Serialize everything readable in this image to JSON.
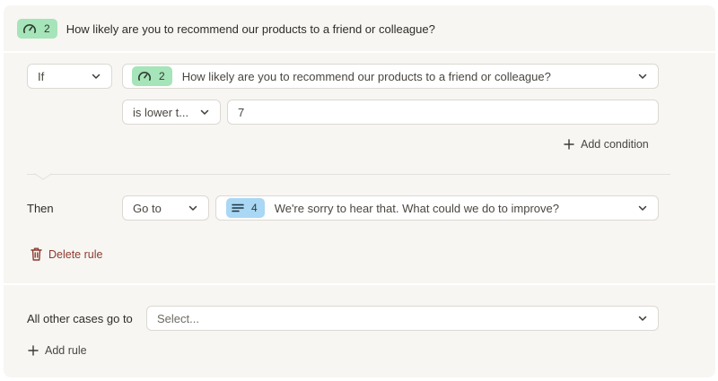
{
  "header": {
    "question_number": "2",
    "question_text": "How likely are you to recommend our products to a friend or colleague?",
    "question_icon": "gauge-icon"
  },
  "rule": {
    "if_label": "If",
    "condition_question_number": "2",
    "condition_question_text": "How likely are you to recommend our products to a friend or colleague?",
    "operator": "is lower t...",
    "value": "7",
    "add_condition_label": "Add condition",
    "then_label": "Then",
    "action": "Go to",
    "target_number": "4",
    "target_text": "We're sorry to hear that. What could we do to improve?",
    "target_icon": "text-lines-icon",
    "delete_label": "Delete rule"
  },
  "footer": {
    "other_cases_label": "All other cases go to",
    "select_placeholder": "Select...",
    "add_rule_label": "Add rule"
  },
  "colors": {
    "green_badge": "#a6e4b9",
    "blue_badge": "#a9d7f4",
    "delete_red": "#8c3b2f",
    "panel_bg": "#f7f6f3"
  }
}
